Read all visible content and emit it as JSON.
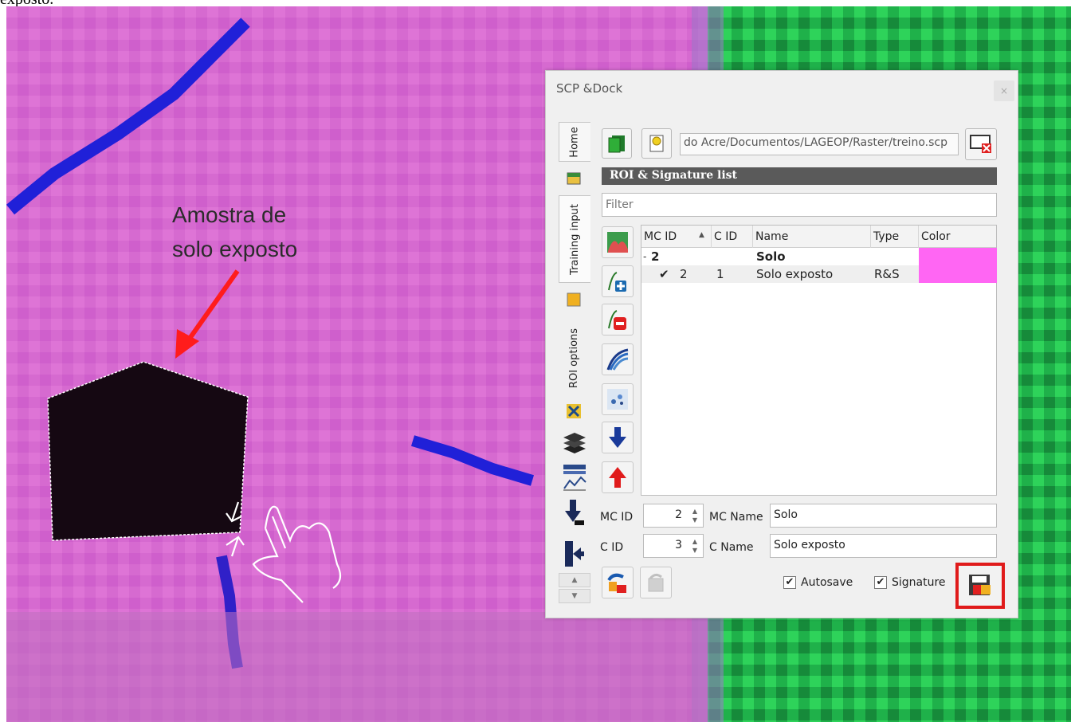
{
  "caption": "exposto.",
  "annotation": {
    "line1": "Amostra de",
    "line2": "solo exposto"
  },
  "dock": {
    "title": "SCP &Dock",
    "close_glyph": "×",
    "tabs": {
      "home": "Home",
      "training": "Training input",
      "roi": "ROI options"
    },
    "path": "do Acre/Documentos/LAGEOP/Raster/treino.scp",
    "section_header": "ROI & Signature list",
    "filter_placeholder": "Filter",
    "table": {
      "columns": [
        "MC ID",
        "C ID",
        "Name",
        "Type",
        "Color"
      ],
      "rows": [
        {
          "expander": "-",
          "mc_id": "2",
          "c_id": "",
          "name": "Solo",
          "type": "",
          "color": "#ff66f3"
        },
        {
          "checked": "✔",
          "mc_id": "2",
          "c_id": "1",
          "name": "Solo exposto",
          "type": "R&S",
          "color": "#ff66f3"
        }
      ]
    },
    "fields": {
      "mc_id_label": "MC ID",
      "mc_id_value": "2",
      "mc_name_label": "MC Name",
      "mc_name_value": "Solo",
      "c_id_label": "C ID",
      "c_id_value": "3",
      "c_name_label": "C Name",
      "c_name_value": "Solo exposto"
    },
    "checkboxes": {
      "autosave": "Autosave",
      "signature": "Signature",
      "check_glyph": "✔"
    }
  },
  "colors": {
    "magenta_bg": "#d66ad0",
    "green_bg": "#1fb14a",
    "highlight": "#e01b1b"
  }
}
